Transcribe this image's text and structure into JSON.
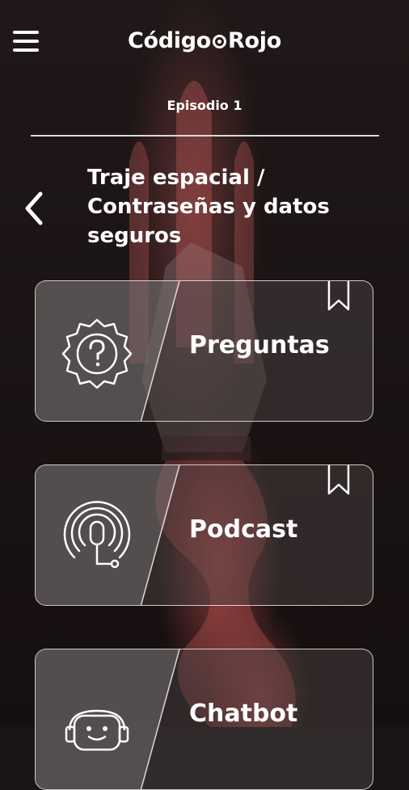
{
  "header": {
    "logo_left": "Código",
    "logo_right": "Rojo",
    "menu_icon": "hamburger-menu-icon"
  },
  "episode": {
    "label": "Episodio 1"
  },
  "page": {
    "title_lines": [
      "Traje espacial /",
      "Contraseñas y datos",
      "seguros"
    ],
    "back_icon": "chevron-left-icon"
  },
  "cards": [
    {
      "label": "Preguntas",
      "icon": "question-badge-icon",
      "bookmark_icon": "bookmark-icon"
    },
    {
      "label": "Podcast",
      "icon": "podcast-microphone-icon",
      "bookmark_icon": "bookmark-icon"
    },
    {
      "label": "Chatbot",
      "icon": "robot-headset-icon"
    }
  ],
  "colors": {
    "background": "#1b1414",
    "accent_red": "#c85050"
  }
}
